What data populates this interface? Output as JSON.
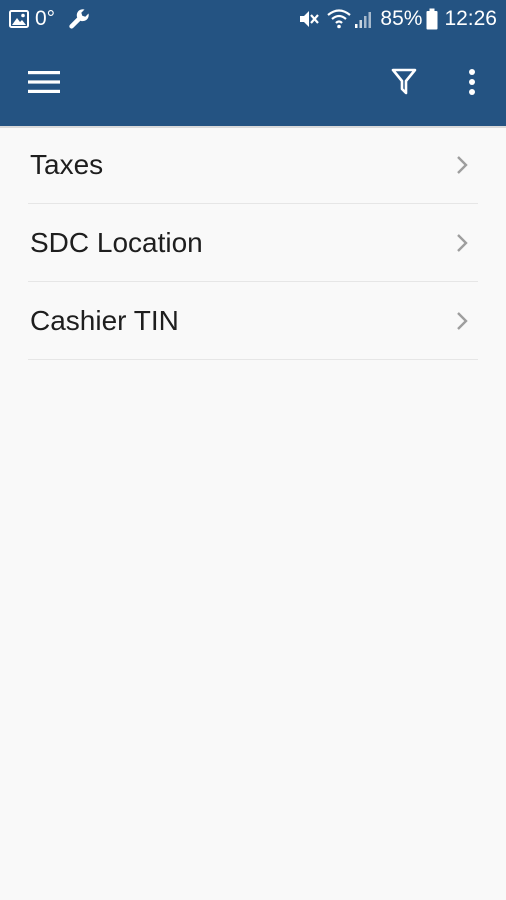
{
  "status_bar": {
    "temperature": "0°",
    "battery": "85%",
    "time": "12:26",
    "icons": [
      "image-icon",
      "wrench-icon",
      "mute-icon",
      "wifi-icon",
      "signal-icon",
      "battery-icon"
    ]
  },
  "app_bar": {
    "background": "#245382",
    "icons": [
      "menu-icon",
      "filter-icon",
      "more-vert-icon"
    ]
  },
  "list": {
    "items": [
      {
        "label": "Taxes"
      },
      {
        "label": "SDC Location"
      },
      {
        "label": "Cashier TIN"
      }
    ]
  }
}
